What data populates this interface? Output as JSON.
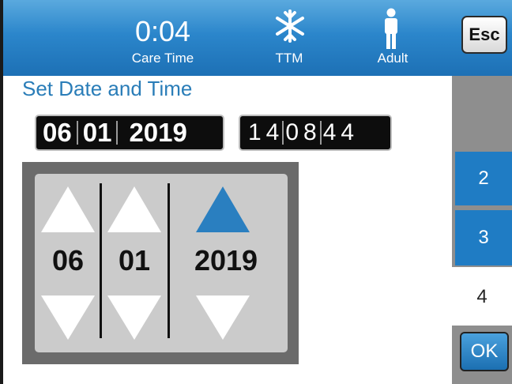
{
  "header": {
    "care_time_value": "0:04",
    "care_time_label": "Care Time",
    "mode_label": "TTM",
    "mode_icon": "snowflake-icon",
    "patient_label": "Adult",
    "patient_icon": "person-icon",
    "esc_label": "Esc"
  },
  "page": {
    "title": "Set Date and Time"
  },
  "date_display": {
    "month": "06",
    "day": "01",
    "year": "2019"
  },
  "time_display": {
    "hour": "14",
    "minute": "08",
    "second": "44"
  },
  "picker": {
    "month": "06",
    "day": "01",
    "year": "2019",
    "active_field": "year"
  },
  "side_tabs": [
    "2",
    "3",
    "4"
  ],
  "ok_label": "OK",
  "colors": {
    "header_blue": "#2b86cb",
    "accent_blue": "#2a7fc0",
    "title_blue": "#2a7db8"
  }
}
